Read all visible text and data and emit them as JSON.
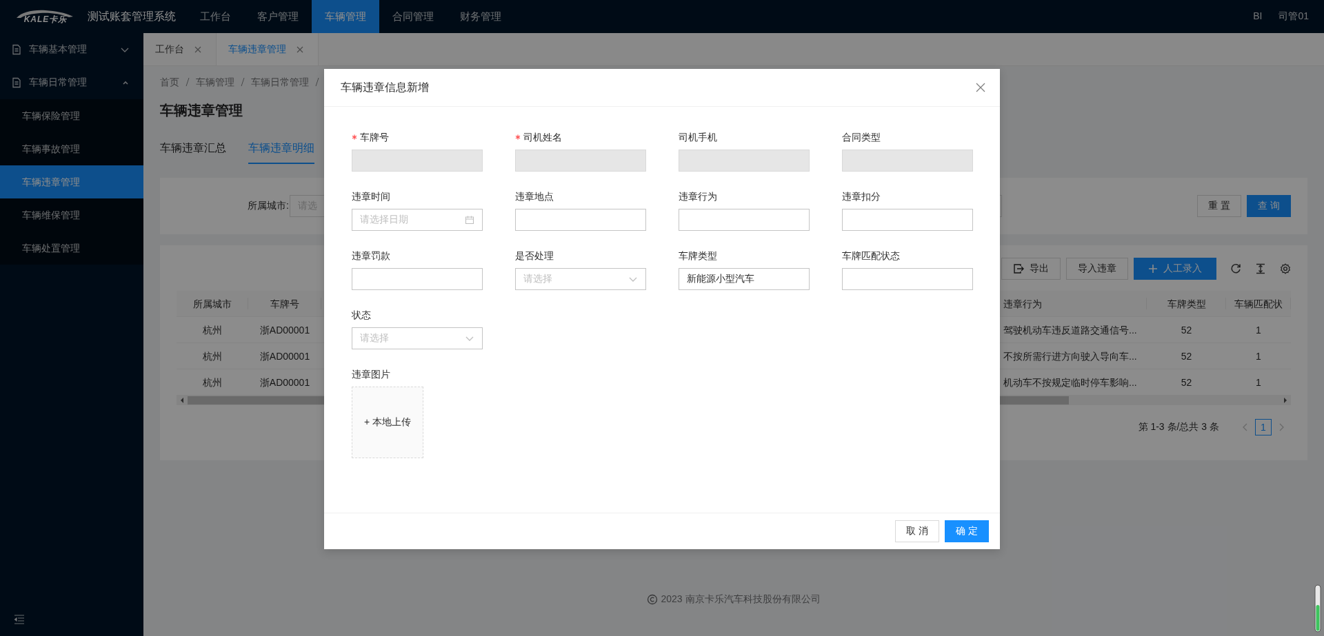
{
  "header": {
    "logo": "KALE卡乐",
    "title": "测试账套管理系统",
    "nav": [
      {
        "label": "工作台",
        "selected": false
      },
      {
        "label": "客户管理",
        "selected": false
      },
      {
        "label": "车辆管理",
        "selected": true
      },
      {
        "label": "合同管理",
        "selected": false
      },
      {
        "label": "财务管理",
        "selected": false
      }
    ],
    "user_links": [
      "BI",
      "司管01"
    ]
  },
  "sidebar": {
    "groups": [
      {
        "label": "车辆基本管理",
        "expanded": false
      },
      {
        "label": "车辆日常管理",
        "expanded": true,
        "children": [
          {
            "label": "车辆保险管理",
            "selected": false
          },
          {
            "label": "车辆事故管理",
            "selected": false
          },
          {
            "label": "车辆违章管理",
            "selected": true
          },
          {
            "label": "车辆维保管理",
            "selected": false
          },
          {
            "label": "车辆处置管理",
            "selected": false
          }
        ]
      }
    ]
  },
  "tabs": [
    {
      "label": "工作台",
      "selected": false
    },
    {
      "label": "车辆违章管理",
      "selected": true
    }
  ],
  "breadcrumb": [
    "首页",
    "车辆管理",
    "车辆日常管理"
  ],
  "page_title": "车辆违章管理",
  "sub_tabs": [
    {
      "label": "车辆违章汇总",
      "selected": false
    },
    {
      "label": "车辆违章明细",
      "selected": true
    }
  ],
  "search": {
    "fields": [
      {
        "kind": "select",
        "label": "所属城市:",
        "placeholder": "请选"
      },
      {
        "kind": "blank"
      }
    ],
    "buttons": [
      {
        "label": "重 置",
        "kind": "default"
      },
      {
        "label": "查 询",
        "kind": "primary"
      }
    ]
  },
  "table_toolbar": {
    "buttons": [
      {
        "label": "导出",
        "kind": "export"
      },
      {
        "label": "导入违章",
        "kind": "default"
      },
      {
        "label": "人工录入",
        "kind": "add"
      }
    ]
  },
  "table": {
    "columns": [
      "所属城市",
      "车牌号",
      "违章行为",
      "车牌类型",
      "车辆匹配状"
    ],
    "rows": [
      {
        "cells": [
          "杭州",
          "浙AD00001",
          "驾驶机动车违反道路交通信号...",
          "52",
          "1"
        ]
      },
      {
        "cells": [
          "杭州",
          "浙AD00001",
          "不按所需行进方向驶入导向车...",
          "52",
          "1"
        ]
      },
      {
        "cells": [
          "杭州",
          "浙AD00001",
          "机动车不按规定临时停车影响...",
          "52",
          "1"
        ]
      }
    ]
  },
  "pagination": {
    "summary": "第 1-3 条/总共 3 条",
    "pages": [
      {
        "label": "1",
        "selected": true
      }
    ]
  },
  "footer": "2023 南京卡乐汽车科技股份有限公司",
  "modal": {
    "title": "车辆违章信息新增",
    "fields": [
      {
        "label": "车牌号",
        "required": true,
        "kind": "text",
        "disabled": true
      },
      {
        "label": "司机姓名",
        "required": true,
        "kind": "text",
        "disabled": true
      },
      {
        "label": "司机手机",
        "required": false,
        "kind": "text",
        "disabled": true
      },
      {
        "label": "合同类型",
        "required": false,
        "kind": "text",
        "disabled": true
      },
      {
        "label": "违章时间",
        "required": false,
        "kind": "date",
        "disabled": false,
        "placeholder": "请选择日期"
      },
      {
        "label": "违章地点",
        "required": false,
        "kind": "text",
        "disabled": false
      },
      {
        "label": "违章行为",
        "required": false,
        "kind": "text",
        "disabled": false
      },
      {
        "label": "违章扣分",
        "required": false,
        "kind": "text",
        "disabled": false
      },
      {
        "label": "违章罚款",
        "required": false,
        "kind": "text",
        "disabled": false
      },
      {
        "label": "是否处理",
        "required": false,
        "kind": "select",
        "disabled": false,
        "placeholder": "请选择"
      },
      {
        "label": "车牌类型",
        "required": false,
        "kind": "text",
        "disabled": false,
        "value": "新能源小型汽车"
      },
      {
        "label": "车牌匹配状态",
        "required": false,
        "kind": "text",
        "disabled": false
      },
      {
        "label": "状态",
        "required": false,
        "kind": "select",
        "disabled": false,
        "placeholder": "请选择"
      }
    ],
    "upload": {
      "label": "违章图片",
      "button": "+ 本地上传"
    },
    "buttons": [
      {
        "label": "取 消",
        "kind": "default"
      },
      {
        "label": "确 定",
        "kind": "primary"
      }
    ]
  }
}
